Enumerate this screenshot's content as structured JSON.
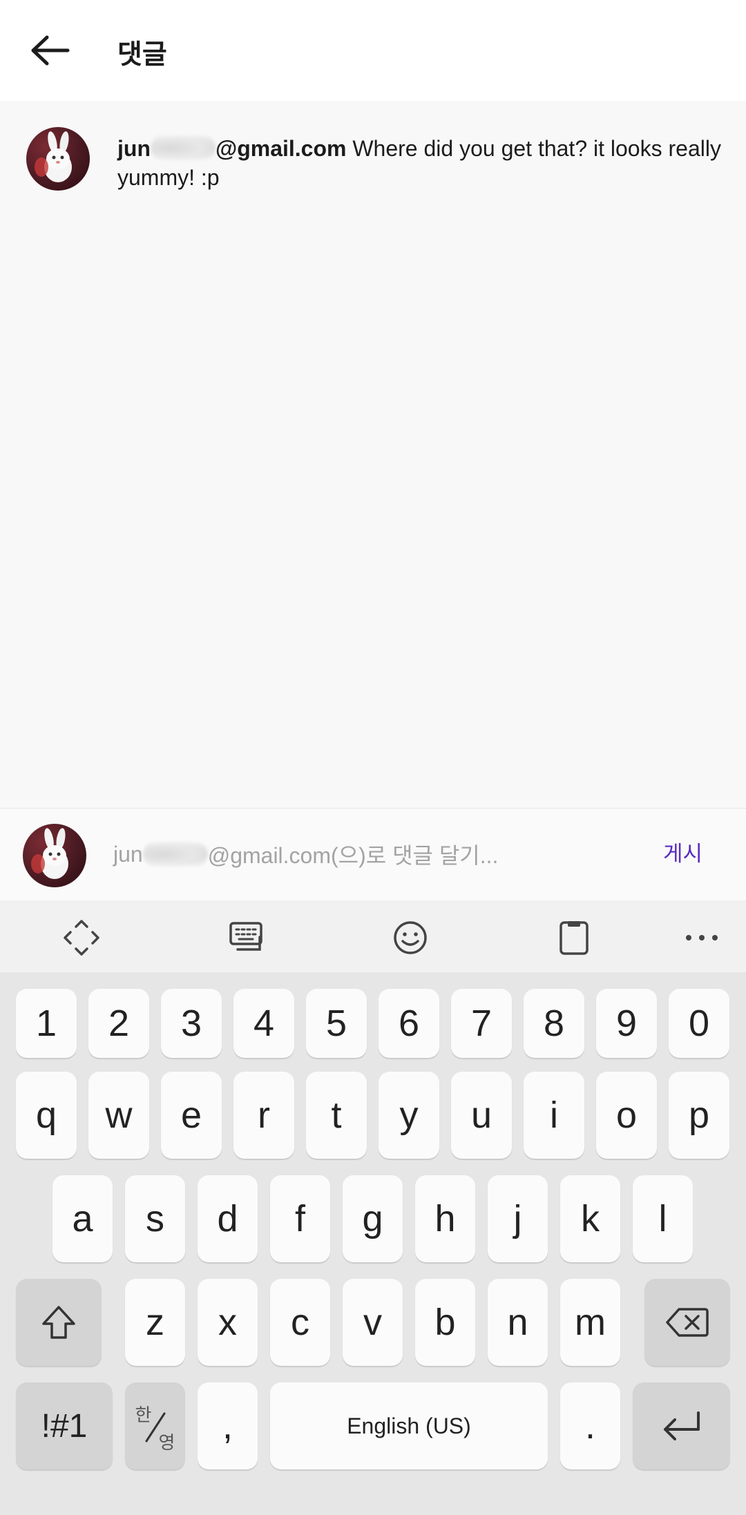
{
  "header": {
    "title": "댓글"
  },
  "comment": {
    "author_prefix": "jun",
    "author_suffix": "@gmail.com",
    "text": " Where did you get that? it looks really yummy! :p"
  },
  "input_bar": {
    "placeholder_prefix": "jun",
    "placeholder_suffix": "@gmail.com(으)로 댓글 달기...",
    "post_label": "게시"
  },
  "keyboard": {
    "toolbar": [
      "move-icon",
      "keyboard-icon",
      "emoji-icon",
      "clipboard-icon",
      "more-icon"
    ],
    "row_numbers": [
      "1",
      "2",
      "3",
      "4",
      "5",
      "6",
      "7",
      "8",
      "9",
      "0"
    ],
    "row_top": [
      "q",
      "w",
      "e",
      "r",
      "t",
      "y",
      "u",
      "i",
      "o",
      "p"
    ],
    "row_middle": [
      "a",
      "s",
      "d",
      "f",
      "g",
      "h",
      "j",
      "k",
      "l"
    ],
    "row_bottom": [
      "z",
      "x",
      "c",
      "v",
      "b",
      "n",
      "m"
    ],
    "symbols_label": "!#1",
    "lang_top": "한",
    "lang_bottom": "영",
    "comma": ",",
    "space_label": "English (US)",
    "period": "."
  },
  "colors": {
    "accent": "#5a2bbf",
    "background": "#f8f8f8",
    "keyboard_bg": "#e6e6e6"
  }
}
